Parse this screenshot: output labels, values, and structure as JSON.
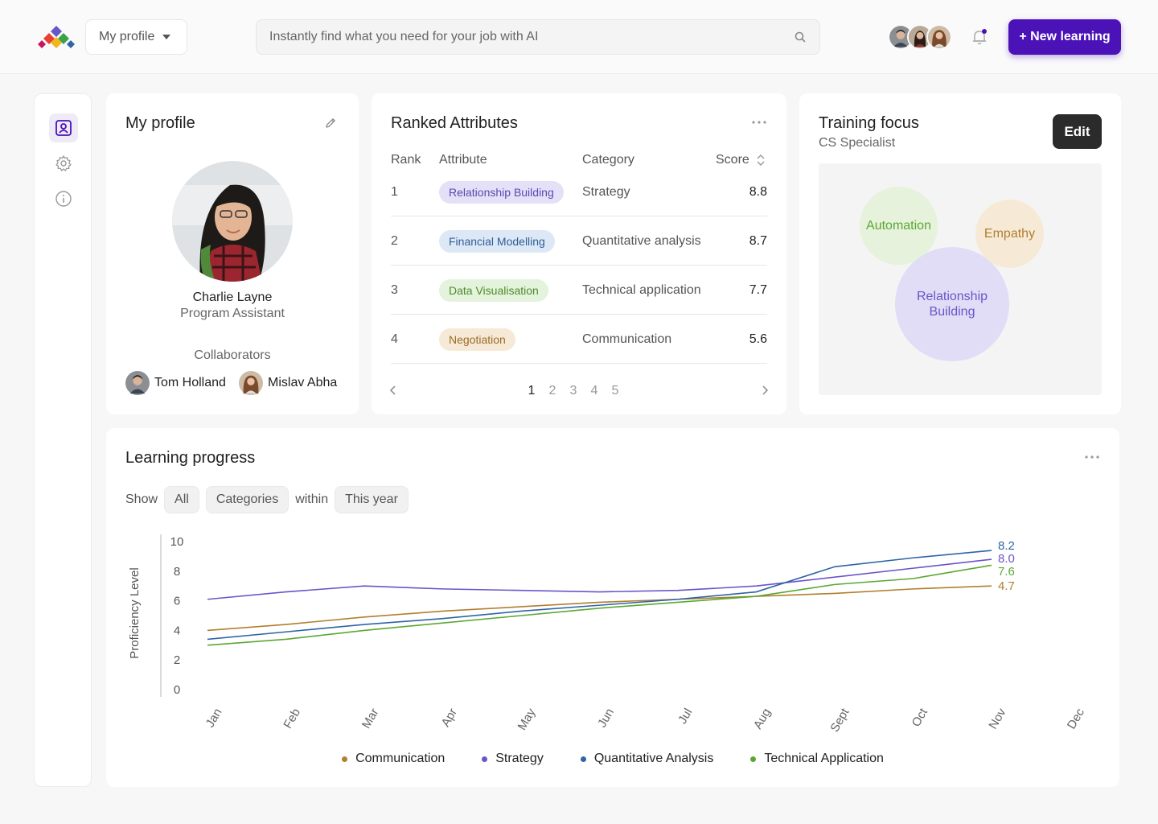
{
  "header": {
    "profile_dropdown": "My profile",
    "search_placeholder": "Instantly find what you need for your job with AI",
    "new_learning": "+ New learning"
  },
  "profile": {
    "title": "My profile",
    "name": "Charlie Layne",
    "role": "Program Assistant",
    "collaborators_label": "Collaborators",
    "collaborators": [
      "Tom Holland",
      "Mislav Abha"
    ]
  },
  "ranked": {
    "title": "Ranked Attributes",
    "headers": [
      "Rank",
      "Attribute",
      "Category",
      "Score"
    ],
    "rows": [
      {
        "rank": "1",
        "attribute": "Relationship Building",
        "category": "Strategy",
        "score": "8.8",
        "chip_bg": "#e4e0f7",
        "chip_fg": "#5a48b0"
      },
      {
        "rank": "2",
        "attribute": "Financial Modelling",
        "category": "Quantitative analysis",
        "score": "8.7",
        "chip_bg": "#dde8f6",
        "chip_fg": "#2f5d94"
      },
      {
        "rank": "3",
        "attribute": "Data Visualisation",
        "category": "Technical application",
        "score": "7.7",
        "chip_bg": "#e4f3dc",
        "chip_fg": "#4f8a2c"
      },
      {
        "rank": "4",
        "attribute": "Negotiation",
        "category": "Communication",
        "score": "5.6",
        "chip_bg": "#f6ead7",
        "chip_fg": "#9c6a26"
      }
    ],
    "pages": [
      "1",
      "2",
      "3",
      "4",
      "5"
    ]
  },
  "training": {
    "title": "Training focus",
    "subtitle": "CS Specialist",
    "edit": "Edit",
    "bubbles": [
      "Automation",
      "Empathy",
      "Relationship Building"
    ]
  },
  "progress": {
    "title": "Learning progress",
    "show": "Show",
    "all": "All",
    "categories": "Categories",
    "within": "within",
    "period": "This year"
  },
  "colors": {
    "accent": "#4b12b8",
    "communication": "#b07f2e",
    "strategy": "#6a55c8",
    "quantitative": "#2f64a6",
    "technical": "#5aa832"
  },
  "chart_data": {
    "type": "line",
    "ylabel": "Proficiency Level",
    "xlabel": "",
    "ylim": [
      0,
      10
    ],
    "yticks": [
      0,
      2,
      4,
      6,
      8,
      10
    ],
    "categories": [
      "Jan",
      "Feb",
      "Mar",
      "Apr",
      "May",
      "Jun",
      "Jul",
      "Aug",
      "Sept",
      "Oct",
      "Nov",
      "Dec"
    ],
    "series": [
      {
        "name": "Communication",
        "color": "#b07f2e",
        "values": [
          4.0,
          4.4,
          4.9,
          5.3,
          5.6,
          5.9,
          6.1,
          6.3,
          6.5,
          6.8,
          7.0,
          null
        ],
        "end_label": "4.7"
      },
      {
        "name": "Strategy",
        "color": "#6a55c8",
        "values": [
          6.1,
          6.6,
          7.0,
          6.8,
          6.7,
          6.6,
          6.7,
          7.0,
          7.6,
          8.2,
          8.8,
          null
        ],
        "end_label": "8.0"
      },
      {
        "name": "Quantitative Analysis",
        "color": "#2f64a6",
        "values": [
          3.4,
          3.9,
          4.4,
          4.8,
          5.3,
          5.7,
          6.1,
          6.6,
          8.3,
          8.9,
          9.4,
          null
        ],
        "end_label": "8.2"
      },
      {
        "name": "Technical Application",
        "color": "#5aa832",
        "values": [
          3.0,
          3.4,
          4.0,
          4.5,
          5.0,
          5.5,
          5.9,
          6.3,
          7.1,
          7.5,
          8.4,
          null
        ],
        "end_label": "7.6"
      }
    ]
  }
}
